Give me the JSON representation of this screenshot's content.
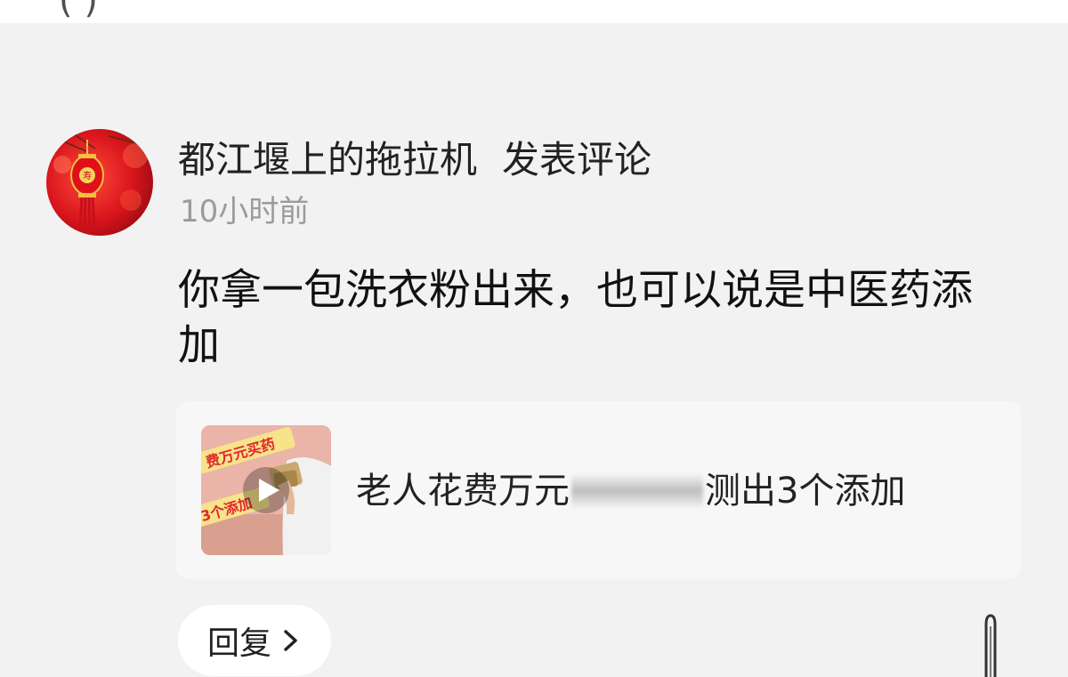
{
  "comment": {
    "author": "都江堰上的拖拉机",
    "action": "发表评论",
    "time": "10小时前",
    "text": "你拿一包洗衣粉出来，也可以说是中医药添加"
  },
  "video_card": {
    "title_before": "老人花费万元",
    "title_after": "测出3个添加",
    "thumbnail_texts": [
      "费万元买药",
      "3个添加"
    ],
    "icon": "play-icon"
  },
  "reply": {
    "label": "回复",
    "icon": "chevron-right-icon"
  },
  "colors": {
    "background": "#f2f2f2",
    "card": "#f7f7f7",
    "time_gray": "#9b9b9b",
    "avatar_red": "#d8141c"
  }
}
